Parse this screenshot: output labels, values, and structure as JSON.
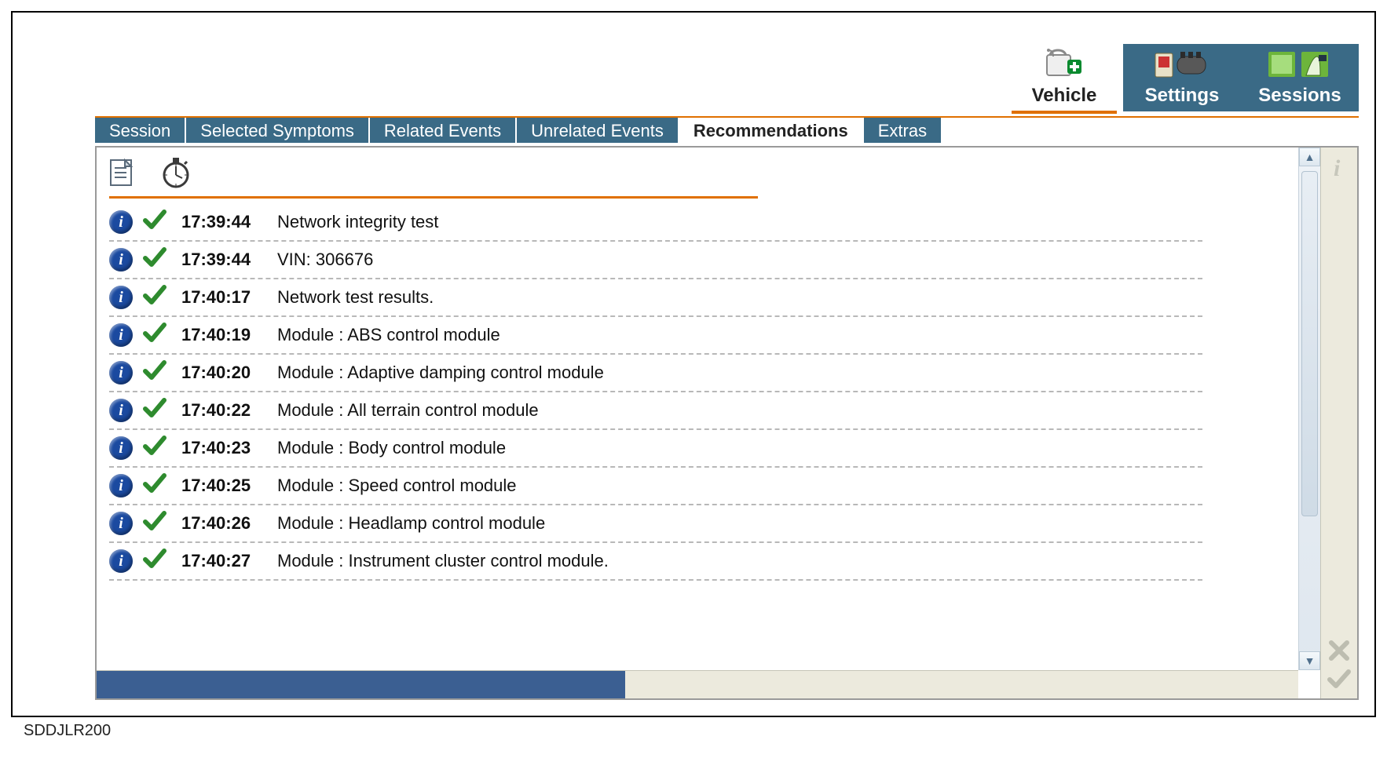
{
  "caption": "SDDJLR200",
  "topnav": {
    "items": [
      {
        "label": "Vehicle",
        "active": true
      },
      {
        "label": "Settings",
        "active": false
      },
      {
        "label": "Sessions",
        "active": false
      }
    ]
  },
  "tabs": {
    "items": [
      {
        "label": "Session",
        "active": false
      },
      {
        "label": "Selected Symptoms",
        "active": false
      },
      {
        "label": "Related Events",
        "active": false
      },
      {
        "label": "Unrelated Events",
        "active": false
      },
      {
        "label": "Recommendations",
        "active": true
      },
      {
        "label": "Extras",
        "active": false
      }
    ]
  },
  "list": {
    "rows": [
      {
        "time": "17:39:44",
        "desc": "Network integrity test"
      },
      {
        "time": "17:39:44",
        "desc": "VIN: 306676"
      },
      {
        "time": "17:40:17",
        "desc": "Network test results."
      },
      {
        "time": "17:40:19",
        "desc": "Module : ABS control module"
      },
      {
        "time": "17:40:20",
        "desc": "Module : Adaptive damping control module"
      },
      {
        "time": "17:40:22",
        "desc": "Module : All terrain control module"
      },
      {
        "time": "17:40:23",
        "desc": "Module : Body control module"
      },
      {
        "time": "17:40:25",
        "desc": "Module : Speed control module"
      },
      {
        "time": "17:40:26",
        "desc": "Module : Headlamp control module"
      },
      {
        "time": "17:40:27",
        "desc": "Module : Instrument cluster control module."
      }
    ]
  },
  "info_glyph": "i"
}
